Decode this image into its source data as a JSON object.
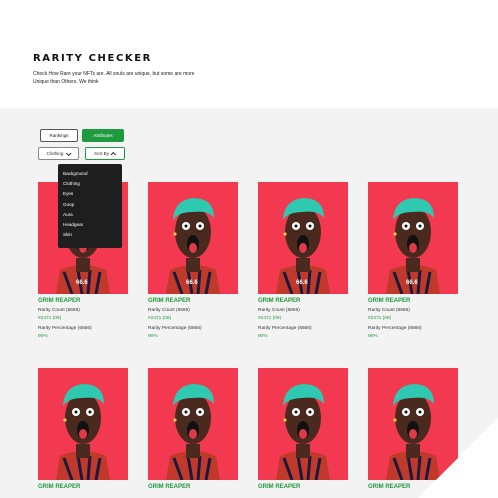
{
  "header": {
    "title": "RARITY CHECKER",
    "subtitle": "Check How Rare your NFTs are. All souls are unique, but some are more Unique than Others. We think"
  },
  "tabs": {
    "rankings": "Rankings",
    "attributes": "Attributes"
  },
  "filters": {
    "clothing": "Clothing",
    "sort": "Sort By"
  },
  "menu": [
    "Background",
    "Clothing",
    "Eyes",
    "Goop",
    "Aura",
    "Headgear",
    "Skin"
  ],
  "colors": {
    "accent": "#1f9a3e",
    "card_bg": "#f2394f",
    "hair": "#2ec9b0",
    "skin": "#4a2a1e"
  },
  "cards": [
    {
      "name": "GRIM REAPER",
      "count_label": "Rarity Count (6666)",
      "count_value": "#2471  (09)",
      "pct_label": "Rarity Percentage (6666)",
      "pct_value": "90%"
    },
    {
      "name": "GRIM REAPER",
      "count_label": "Rarity Count (6666)",
      "count_value": "#2471  (09)",
      "pct_label": "Rarity Percentage (6666)",
      "pct_value": "90%"
    },
    {
      "name": "GRIM REAPER",
      "count_label": "Rarity Count (6666)",
      "count_value": "#2471  (09)",
      "pct_label": "Rarity Percentage (6666)",
      "pct_value": "90%"
    },
    {
      "name": "GRIM REAPER",
      "count_label": "Rarity Count (6666)",
      "count_value": "#2471  (09)",
      "pct_label": "Rarity Percentage (6666)",
      "pct_value": "90%"
    },
    {
      "name": "GRIM REAPER"
    },
    {
      "name": "GRIM REAPER"
    },
    {
      "name": "GRIM REAPER"
    },
    {
      "name": "GRIM REAPER"
    }
  ]
}
